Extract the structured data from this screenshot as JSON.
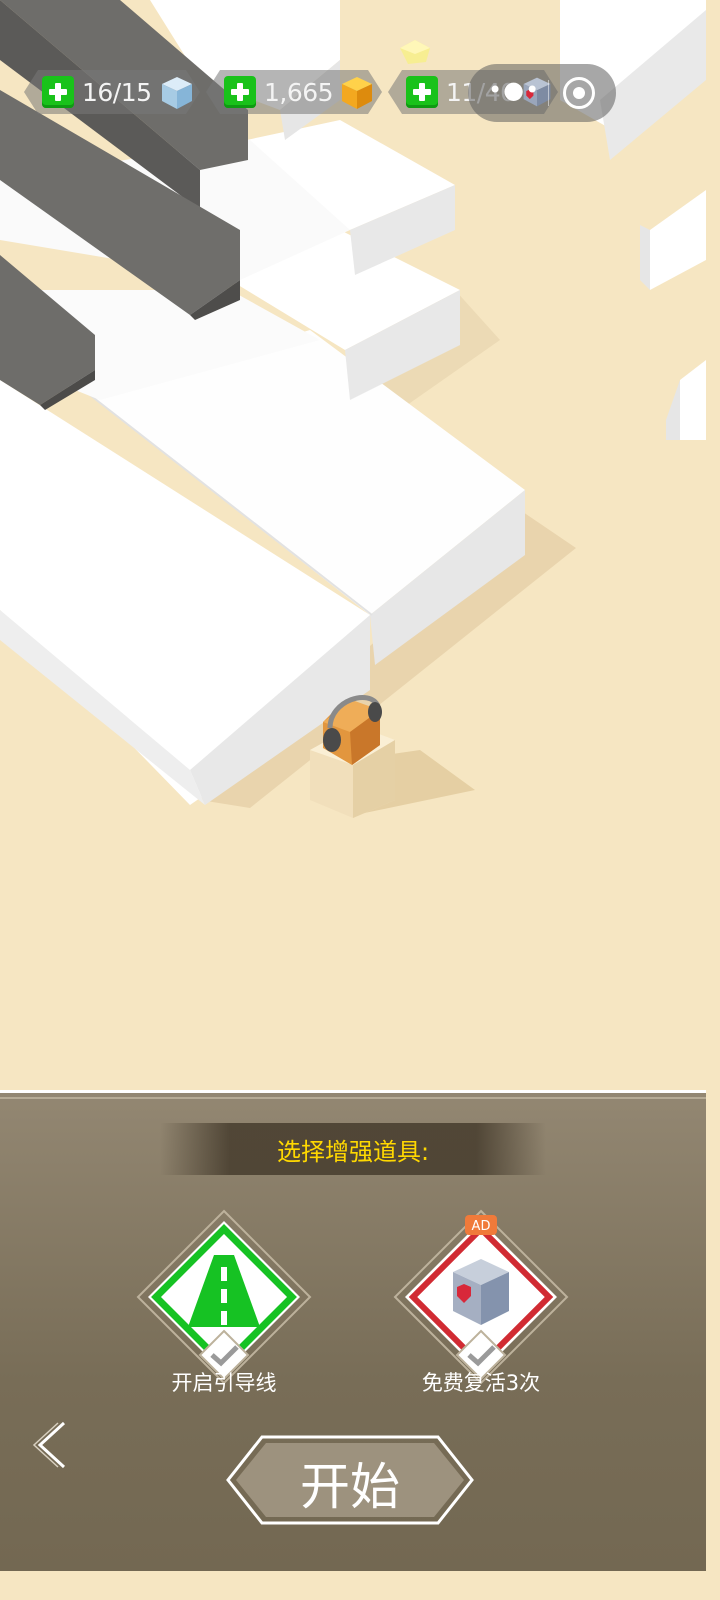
{
  "hud": {
    "ice_count": "16/15",
    "coins": "1,665",
    "third_count": "11/40"
  },
  "menu_capsule": {
    "dots": "•●•"
  },
  "panel": {
    "title": "选择增强道具:",
    "powerups": [
      {
        "label": "开启引导线",
        "icon": "guide-road-icon",
        "selected": true,
        "border_color": "#16c223"
      },
      {
        "label": "免费复活3次",
        "icon": "heart-cube-icon",
        "badge": "AD",
        "selected": true,
        "border_color": "#d12b33"
      }
    ],
    "start_label": "开始"
  },
  "colors": {
    "background": "#f6e6c2",
    "panel": "#786d57",
    "title": "#ffd800",
    "accent_green": "#19c21a"
  }
}
